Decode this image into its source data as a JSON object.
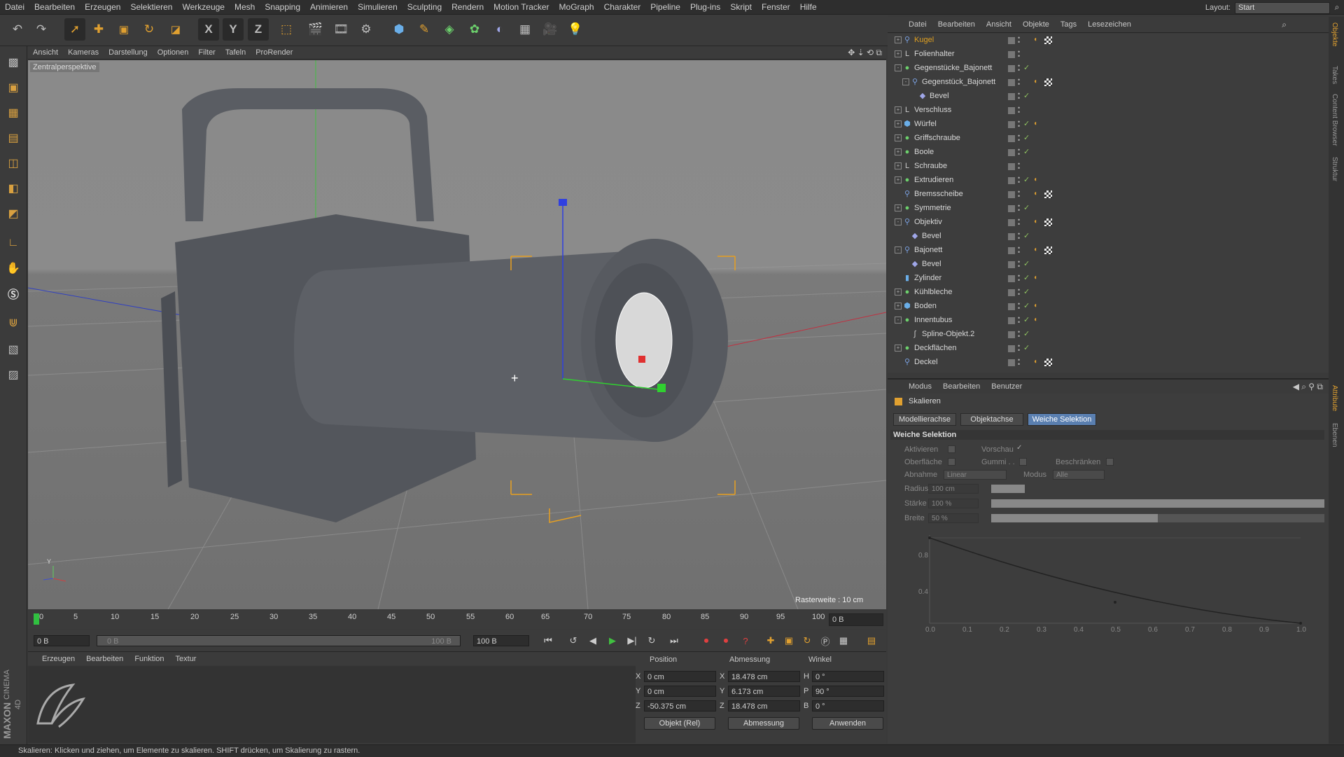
{
  "menubar": {
    "items": [
      "Datei",
      "Bearbeiten",
      "Erzeugen",
      "Selektieren",
      "Werkzeuge",
      "Mesh",
      "Snapping",
      "Animieren",
      "Simulieren",
      "Sculpting",
      "Rendern",
      "Motion Tracker",
      "MoGraph",
      "Charakter",
      "Pipeline",
      "Plug-ins",
      "Skript",
      "Fenster",
      "Hilfe"
    ],
    "layout_label": "Layout:",
    "layout_value": "Start"
  },
  "toolbar": {
    "axis_x": "X",
    "axis_y": "Y",
    "axis_z": "Z"
  },
  "viewport": {
    "menu": [
      "Ansicht",
      "Kameras",
      "Darstellung",
      "Optionen",
      "Filter",
      "Tafeln",
      "ProRender"
    ],
    "camera_label": "Zentralperspektive",
    "grid_info": "Rasterweite : 10 cm",
    "axis_y_label": "Y"
  },
  "timeline": {
    "ticks": [
      "0",
      "5",
      "10",
      "15",
      "20",
      "25",
      "30",
      "35",
      "40",
      "45",
      "50",
      "55",
      "60",
      "65",
      "70",
      "75",
      "80",
      "85",
      "90",
      "95",
      "100"
    ],
    "current_frame": "0 B"
  },
  "transport": {
    "start_field": "0 B",
    "range_start": "0 B",
    "range_end": "100 B",
    "end_field": "100 B"
  },
  "material_manager": {
    "menu": [
      "Erzeugen",
      "Bearbeiten",
      "Funktion",
      "Textur"
    ]
  },
  "coordinates": {
    "headers": {
      "position": "Position",
      "size": "Abmessung",
      "rotation": "Winkel"
    },
    "rows": [
      {
        "axis": "X",
        "pos": "0 cm",
        "size_axis": "X",
        "size": "18.478 cm",
        "rot_axis": "H",
        "rot": "0 °"
      },
      {
        "axis": "Y",
        "pos": "0 cm",
        "size_axis": "Y",
        "size": "6.173 cm",
        "rot_axis": "P",
        "rot": "90 °"
      },
      {
        "axis": "Z",
        "pos": "-50.375 cm",
        "size_axis": "Z",
        "size": "18.478 cm",
        "rot_axis": "B",
        "rot": "0 °"
      }
    ],
    "mode_dropdown": "Objekt (Rel)",
    "size_dropdown": "Abmessung",
    "apply_button": "Anwenden"
  },
  "status": {
    "text": "Skalieren: Klicken und ziehen, um Elemente zu skalieren. SHIFT drücken, um Skalierung zu rastern."
  },
  "object_manager": {
    "menu": [
      "Datei",
      "Bearbeiten",
      "Ansicht",
      "Objekte",
      "Tags",
      "Lesezeichen"
    ],
    "objects": [
      {
        "name": "Kugel",
        "indent": 0,
        "expander": "+",
        "icon": "bone-icon",
        "color": "#e0a020",
        "check": false,
        "tags": "material+checker"
      },
      {
        "name": "Folienhalter",
        "indent": 0,
        "expander": "+",
        "icon": "null-icon",
        "color": "#d8d8d8",
        "check": false,
        "tags": ""
      },
      {
        "name": "Gegenstücke_Bajonett",
        "indent": 0,
        "expander": "-",
        "icon": "generator-icon",
        "color": "#d8d8d8",
        "check": true,
        "tags": ""
      },
      {
        "name": "Gegenstück_Bajonett",
        "indent": 1,
        "expander": "-",
        "icon": "bone-icon",
        "color": "#d8d8d8",
        "check": false,
        "tags": "material+checker"
      },
      {
        "name": "Bevel",
        "indent": 2,
        "expander": "",
        "icon": "deformer-icon",
        "color": "#d8d8d8",
        "check": true,
        "tags": ""
      },
      {
        "name": "Verschluss",
        "indent": 0,
        "expander": "+",
        "icon": "null-icon",
        "color": "#d8d8d8",
        "check": false,
        "tags": ""
      },
      {
        "name": "Würfel",
        "indent": 0,
        "expander": "+",
        "icon": "cube-icon",
        "color": "#d8d8d8",
        "check": true,
        "tags": "material"
      },
      {
        "name": "Griffschraube",
        "indent": 0,
        "expander": "+",
        "icon": "generator-icon",
        "color": "#d8d8d8",
        "check": true,
        "tags": ""
      },
      {
        "name": "Boole",
        "indent": 0,
        "expander": "+",
        "icon": "generator-icon",
        "color": "#d8d8d8",
        "check": true,
        "tags": ""
      },
      {
        "name": "Schraube",
        "indent": 0,
        "expander": "+",
        "icon": "null-icon",
        "color": "#d8d8d8",
        "check": false,
        "tags": ""
      },
      {
        "name": "Extrudieren",
        "indent": 0,
        "expander": "+",
        "icon": "generator-icon",
        "color": "#d8d8d8",
        "check": true,
        "tags": "material"
      },
      {
        "name": "Bremsscheibe",
        "indent": 0,
        "expander": "",
        "icon": "bone-icon",
        "color": "#d8d8d8",
        "check": false,
        "tags": "material+checker"
      },
      {
        "name": "Symmetrie",
        "indent": 0,
        "expander": "+",
        "icon": "generator-icon",
        "color": "#d8d8d8",
        "check": true,
        "tags": ""
      },
      {
        "name": "Objektiv",
        "indent": 0,
        "expander": "-",
        "icon": "bone-icon",
        "color": "#d8d8d8",
        "check": false,
        "tags": "material+checker"
      },
      {
        "name": "Bevel",
        "indent": 1,
        "expander": "",
        "icon": "deformer-icon",
        "color": "#d8d8d8",
        "check": true,
        "tags": ""
      },
      {
        "name": "Bajonett",
        "indent": 0,
        "expander": "-",
        "icon": "bone-icon",
        "color": "#d8d8d8",
        "check": false,
        "tags": "material+checker"
      },
      {
        "name": "Bevel",
        "indent": 1,
        "expander": "",
        "icon": "deformer-icon",
        "color": "#d8d8d8",
        "check": true,
        "tags": ""
      },
      {
        "name": "Zylinder",
        "indent": 0,
        "expander": "",
        "icon": "cylinder-icon",
        "color": "#d8d8d8",
        "check": true,
        "tags": "material"
      },
      {
        "name": "Kühlbleche",
        "indent": 0,
        "expander": "+",
        "icon": "generator-icon",
        "color": "#d8d8d8",
        "check": true,
        "tags": ""
      },
      {
        "name": "Boden",
        "indent": 0,
        "expander": "+",
        "icon": "cube-icon",
        "color": "#d8d8d8",
        "check": true,
        "tags": "material"
      },
      {
        "name": "Innentubus",
        "indent": 0,
        "expander": "-",
        "icon": "generator-icon",
        "color": "#d8d8d8",
        "check": true,
        "tags": "material"
      },
      {
        "name": "Spline-Objekt.2",
        "indent": 1,
        "expander": "",
        "icon": "spline-icon",
        "color": "#d8d8d8",
        "check": true,
        "tags": ""
      },
      {
        "name": "Deckflächen",
        "indent": 0,
        "expander": "+",
        "icon": "generator-icon",
        "color": "#d8d8d8",
        "check": true,
        "tags": ""
      },
      {
        "name": "Deckel",
        "indent": 0,
        "expander": "",
        "icon": "bone-icon",
        "color": "#d8d8d8",
        "check": false,
        "tags": "material+checker"
      }
    ]
  },
  "attribute_manager": {
    "menu": [
      "Modus",
      "Bearbeiten",
      "Benutzer"
    ],
    "tool_title": "Skalieren",
    "tabs": [
      "Modellierachse",
      "Objektachse",
      "Weiche Selektion"
    ],
    "active_tab": "Weiche Selektion",
    "section_title": "Weiche Selektion",
    "activate_label": "Aktivieren",
    "preview_label": "Vorschau",
    "surface_label": "Oberfläche",
    "rubber_label": "Gummi . .",
    "restrict_label": "Beschränken",
    "falloff_label": "Abnahme",
    "falloff_value": "Linear",
    "mode_label": "Modus",
    "mode_value": "Alle",
    "radius_label": "Radius",
    "radius_value": "100 cm",
    "strength_label": "Stärke",
    "strength_value": "100 %",
    "strength_fraction": 1.0,
    "width_label": "Breite",
    "width_value": "50 %",
    "width_fraction": 0.5,
    "curve_y_ticks": [
      "0.8",
      "0.4"
    ],
    "curve_x_ticks": [
      "0.0",
      "0.1",
      "0.2",
      "0.3",
      "0.4",
      "0.5",
      "0.6",
      "0.7",
      "0.8",
      "0.9",
      "1.0"
    ]
  },
  "right_tabs": [
    "Objekte",
    "Takes",
    "Content Browser",
    "Struktur",
    "Attribute",
    "Ebenen"
  ],
  "logo": {
    "vendor": "MAXON",
    "product": "CINEMA 4D"
  }
}
